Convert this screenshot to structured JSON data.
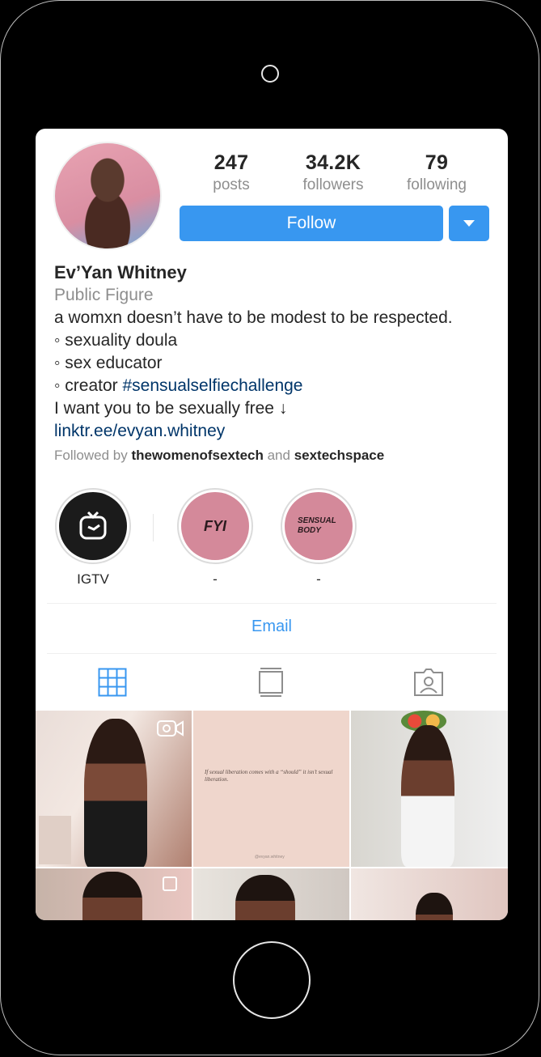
{
  "profile": {
    "stats": [
      {
        "value": "247",
        "label": "posts"
      },
      {
        "value": "34.2K",
        "label": "followers"
      },
      {
        "value": "79",
        "label": "following"
      }
    ],
    "follow_label": "Follow",
    "name": "Ev’Yan Whitney",
    "category": "Public Figure",
    "bio_line1": "a womxn doesn’t have to be modest to be respected.",
    "bio_line2": "◦ sexuality doula",
    "bio_line3": "◦ sex educator",
    "bio_line4_prefix": "◦ creator ",
    "bio_hashtag": "#sensualselfiechallenge",
    "bio_line5": "I want you to be sexually free ↓",
    "link": "linktr.ee/evyan.whitney",
    "followed_by_prefix": "Followed by ",
    "followed_by_user1": "thewomenofsextech",
    "followed_by_and": " and ",
    "followed_by_user2": "sextechspace"
  },
  "highlights": [
    {
      "label": "IGTV",
      "icon": "igtv-icon"
    },
    {
      "label": "-",
      "cover_text": "FYI"
    },
    {
      "label": "-",
      "cover_text": "SENSUAL BODY"
    }
  ],
  "email_label": "Email",
  "tabs": [
    {
      "icon": "grid-icon",
      "active": true
    },
    {
      "icon": "feed-icon",
      "active": false
    },
    {
      "icon": "tagged-icon",
      "active": false
    }
  ],
  "posts": {
    "quote_text": "If sexual liberation comes with a “should” it isn’t sexual liberation.",
    "quote_signature": "@evyan.whitney"
  },
  "colors": {
    "accent": "#3897f0",
    "link": "#003569",
    "muted": "#8e8e8e",
    "text": "#262626",
    "highlight_cover": "#d4899a"
  }
}
